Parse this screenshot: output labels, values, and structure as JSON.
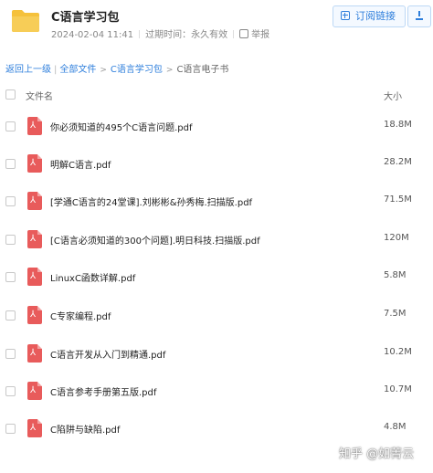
{
  "header": {
    "folder_icon": "folder-icon",
    "title": "C语言学习包",
    "date": "2024-02-04 11:41",
    "expiry": "过期时间：永久有效",
    "report": "举报",
    "subscribe": "订阅链接"
  },
  "breadcrumb": {
    "back": "返回上一级",
    "all_files": "全部文件",
    "folder": "C语言学习包",
    "current": "C语言电子书"
  },
  "columns": {
    "name": "文件名",
    "size": "大小"
  },
  "files": [
    {
      "name": "你必须知道的495个C语言问题.pdf",
      "size": "18.8M"
    },
    {
      "name": "明解C语言.pdf",
      "size": "28.2M"
    },
    {
      "name": "[学通C语言的24堂课].刘彬彬&孙秀梅.扫描版.pdf",
      "size": "71.5M"
    },
    {
      "name": "[C语言必须知道的300个问题].明日科技.扫描版.pdf",
      "size": "120M"
    },
    {
      "name": "LinuxC函数详解.pdf",
      "size": "5.8M"
    },
    {
      "name": "C专家编程.pdf",
      "size": "7.5M"
    },
    {
      "name": "C语言开发从入门到精通.pdf",
      "size": "10.2M"
    },
    {
      "name": "C语言参考手册第五版.pdf",
      "size": "10.7M"
    },
    {
      "name": "C陷阱与缺陷.pdf",
      "size": "4.8M"
    }
  ],
  "watermark": "知乎 @如菁云",
  "colors": {
    "accent": "#2f7fdc",
    "pdf": "#e85b5b",
    "folder": "#f5c13b"
  }
}
